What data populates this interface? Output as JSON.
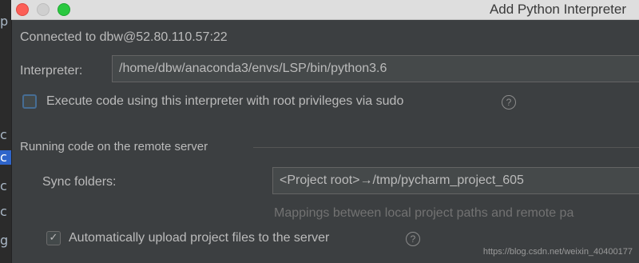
{
  "window": {
    "title": "Add Python Interpreter"
  },
  "left_strip": {
    "glyphs": [
      "p",
      "c",
      "c",
      "c",
      "c",
      "g"
    ]
  },
  "connection": {
    "text": "Connected to dbw@52.80.110.57:22"
  },
  "interpreter": {
    "label": "Interpreter:",
    "value": "/home/dbw/anaconda3/envs/LSP/bin/python3.6"
  },
  "sudo": {
    "label": "Execute code using this interpreter with root privileges via sudo",
    "checked": false,
    "help": "?"
  },
  "remote_section": {
    "title": "Running code on the remote server"
  },
  "sync": {
    "label": "Sync folders:",
    "value": "<Project root>→/tmp/pycharm_project_605",
    "hint": "Mappings between local project paths and remote pa"
  },
  "upload": {
    "label": "Automatically upload project files to the server",
    "checked": true,
    "check_mark": "✓",
    "help": "?"
  },
  "watermark": {
    "text": "https://blog.csdn.net/weixin_40400177"
  },
  "colors": {
    "background": "#3c3f41",
    "field_bg": "#45494a",
    "checkbox_focus": "#466d94",
    "close": "#fc5f57",
    "maximize": "#2ac840"
  },
  "icons": [
    "close-button",
    "minimize-button",
    "maximize-button",
    "help-icon",
    "check-icon"
  ]
}
